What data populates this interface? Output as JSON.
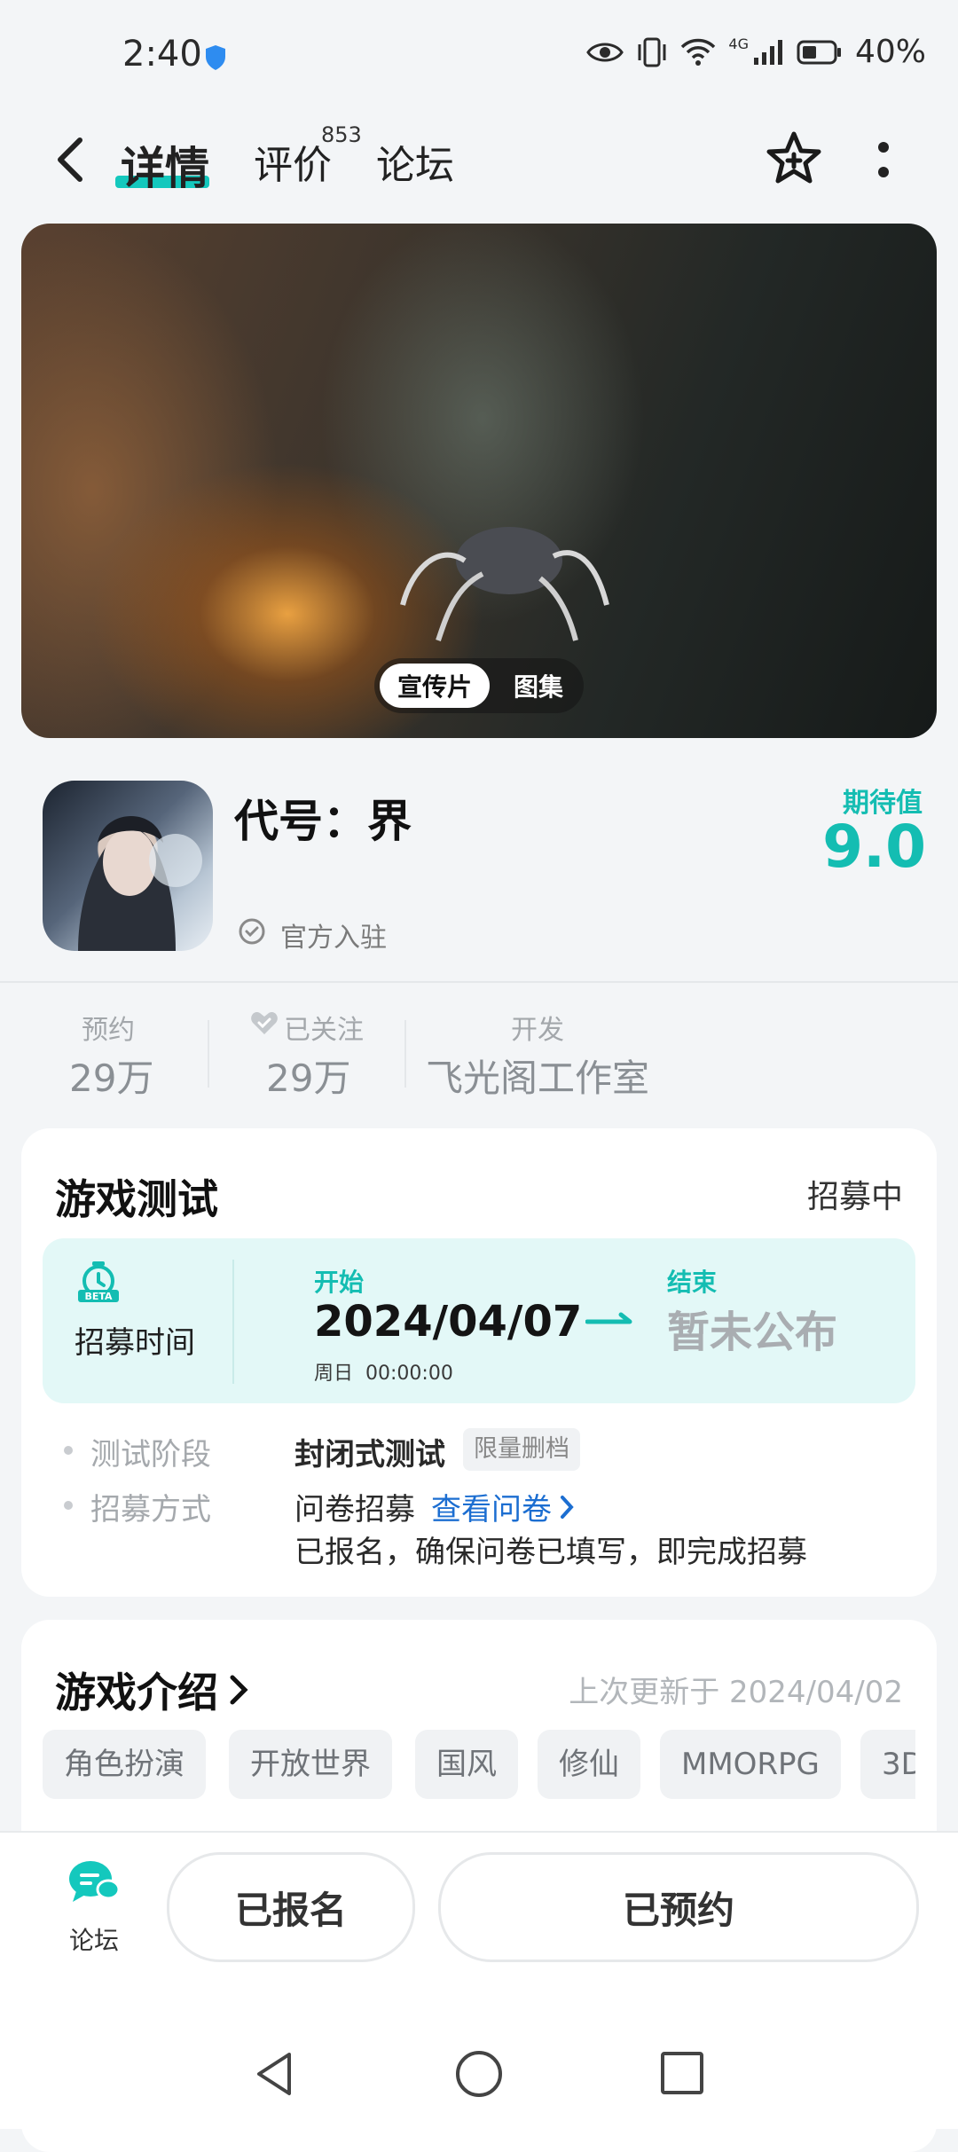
{
  "status_bar": {
    "time": "2:40",
    "network": "4G",
    "battery": "40%"
  },
  "nav": {
    "tabs": [
      {
        "label": "详情",
        "active": true
      },
      {
        "label": "评价",
        "badge": "853"
      },
      {
        "label": "论坛"
      }
    ],
    "icons": [
      "back-icon",
      "star-add-icon",
      "more-icon"
    ]
  },
  "media": {
    "tabs": [
      "宣传片",
      "图集"
    ],
    "active_tab": "宣传片"
  },
  "game": {
    "title": "代号：界",
    "official": "官方入驻",
    "expect_label": "期待值",
    "expect_value": "9.0"
  },
  "stats": [
    {
      "label": "预约",
      "value": "29万"
    },
    {
      "label": "已关注",
      "value": "29万"
    },
    {
      "label": "开发",
      "value": "飞光阁工作室"
    }
  ],
  "test": {
    "title": "游戏测试",
    "status": "招募中",
    "recruit_label": "招募时间",
    "start_label": "开始",
    "start_date": "2024/04/07",
    "start_weekday": "周日",
    "start_time": "00:00:00",
    "end_label": "结束",
    "end_value": "暂未公布",
    "phase_label": "测试阶段",
    "phase_value": "封闭式测试",
    "phase_tag": "限量删档",
    "method_label": "招募方式",
    "method_value": "问卷招募",
    "method_link": "查看问卷",
    "signup_note": "已报名，确保问卷已填写，即完成招募"
  },
  "intro": {
    "title": "游戏介绍",
    "updated": "上次更新于 2024/04/02",
    "tags": [
      "角色扮演",
      "开放世界",
      "国风",
      "修仙",
      "MMORPG",
      "3D"
    ]
  },
  "bottom": {
    "forum_label": "论坛",
    "signed_button": "已报名",
    "reserved_button": "已预约"
  },
  "colors": {
    "accent": "#14c8bd",
    "link": "#1c6ed1",
    "recruit_bg": "#e3f8f7"
  }
}
